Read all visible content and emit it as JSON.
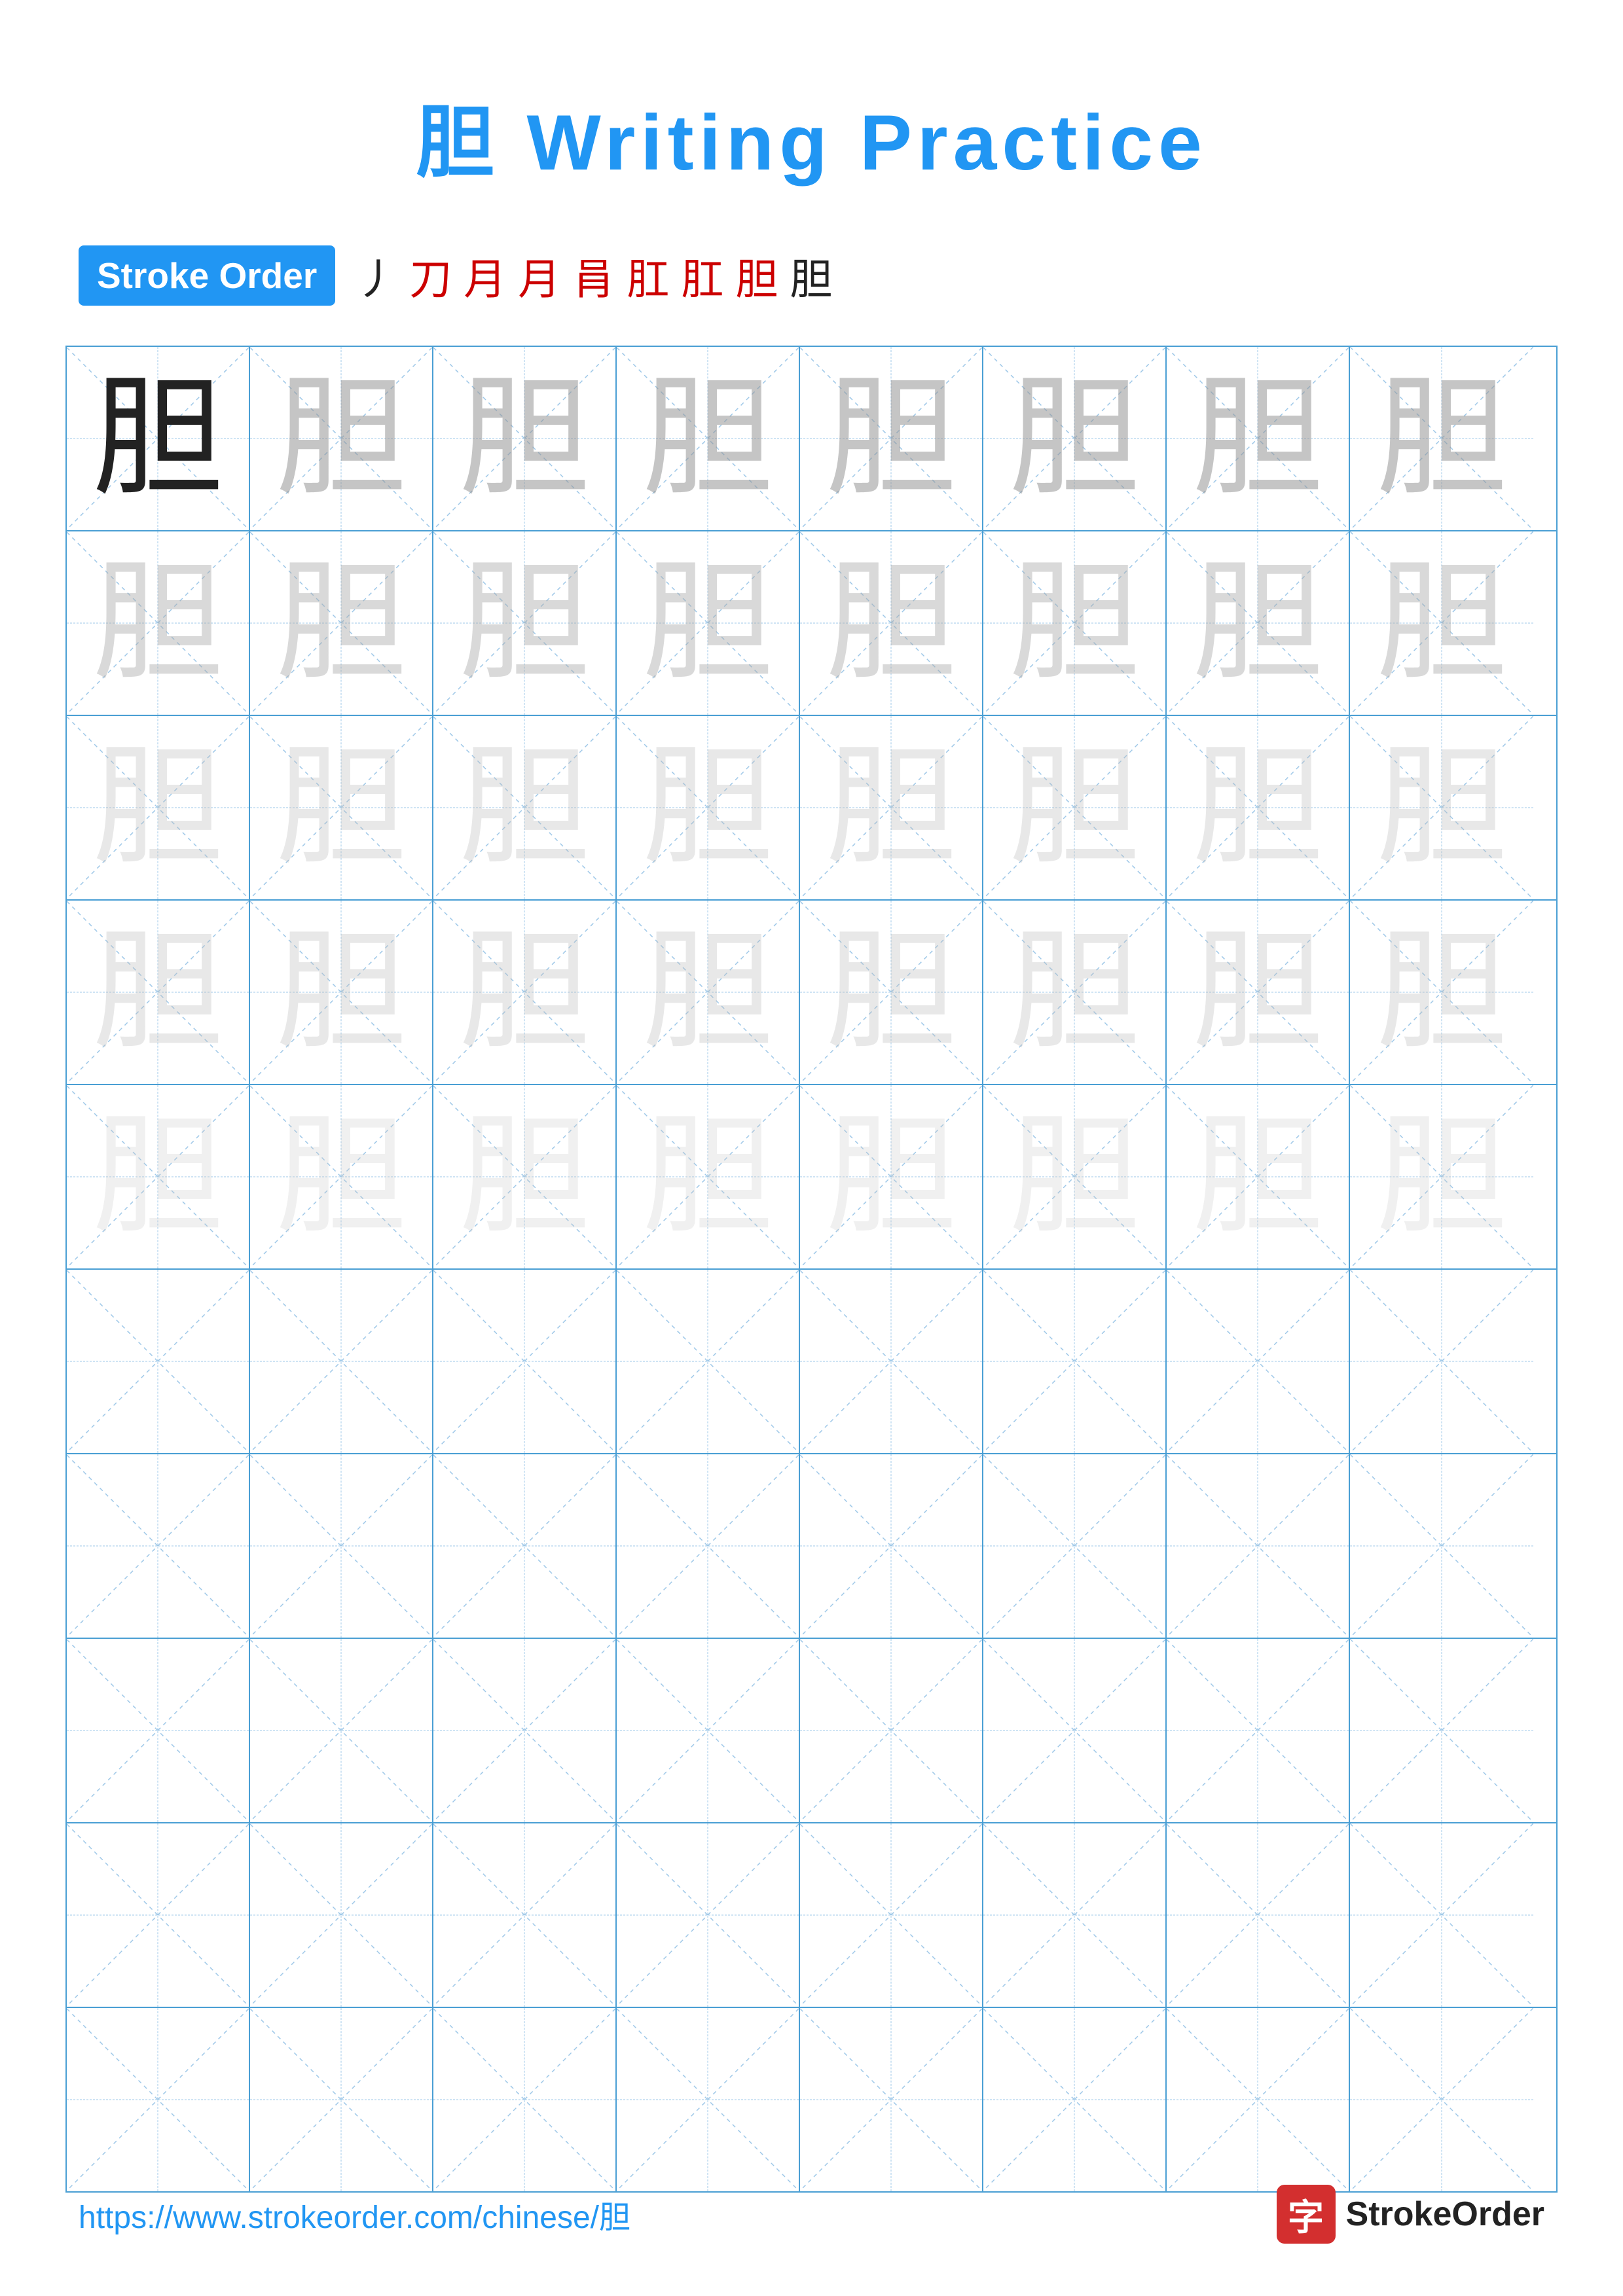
{
  "title": "胆 Writing Practice",
  "stroke_order": {
    "badge_label": "Stroke Order",
    "strokes": [
      "丿",
      "刀",
      "月",
      "月",
      "肙",
      "肛",
      "肛",
      "胆",
      "胆"
    ]
  },
  "character": "胆",
  "grid": {
    "rows": 10,
    "cols": 8
  },
  "footer": {
    "url": "https://www.strokeorder.com/chinese/胆",
    "logo_char": "字",
    "logo_text": "StrokeOrder"
  }
}
